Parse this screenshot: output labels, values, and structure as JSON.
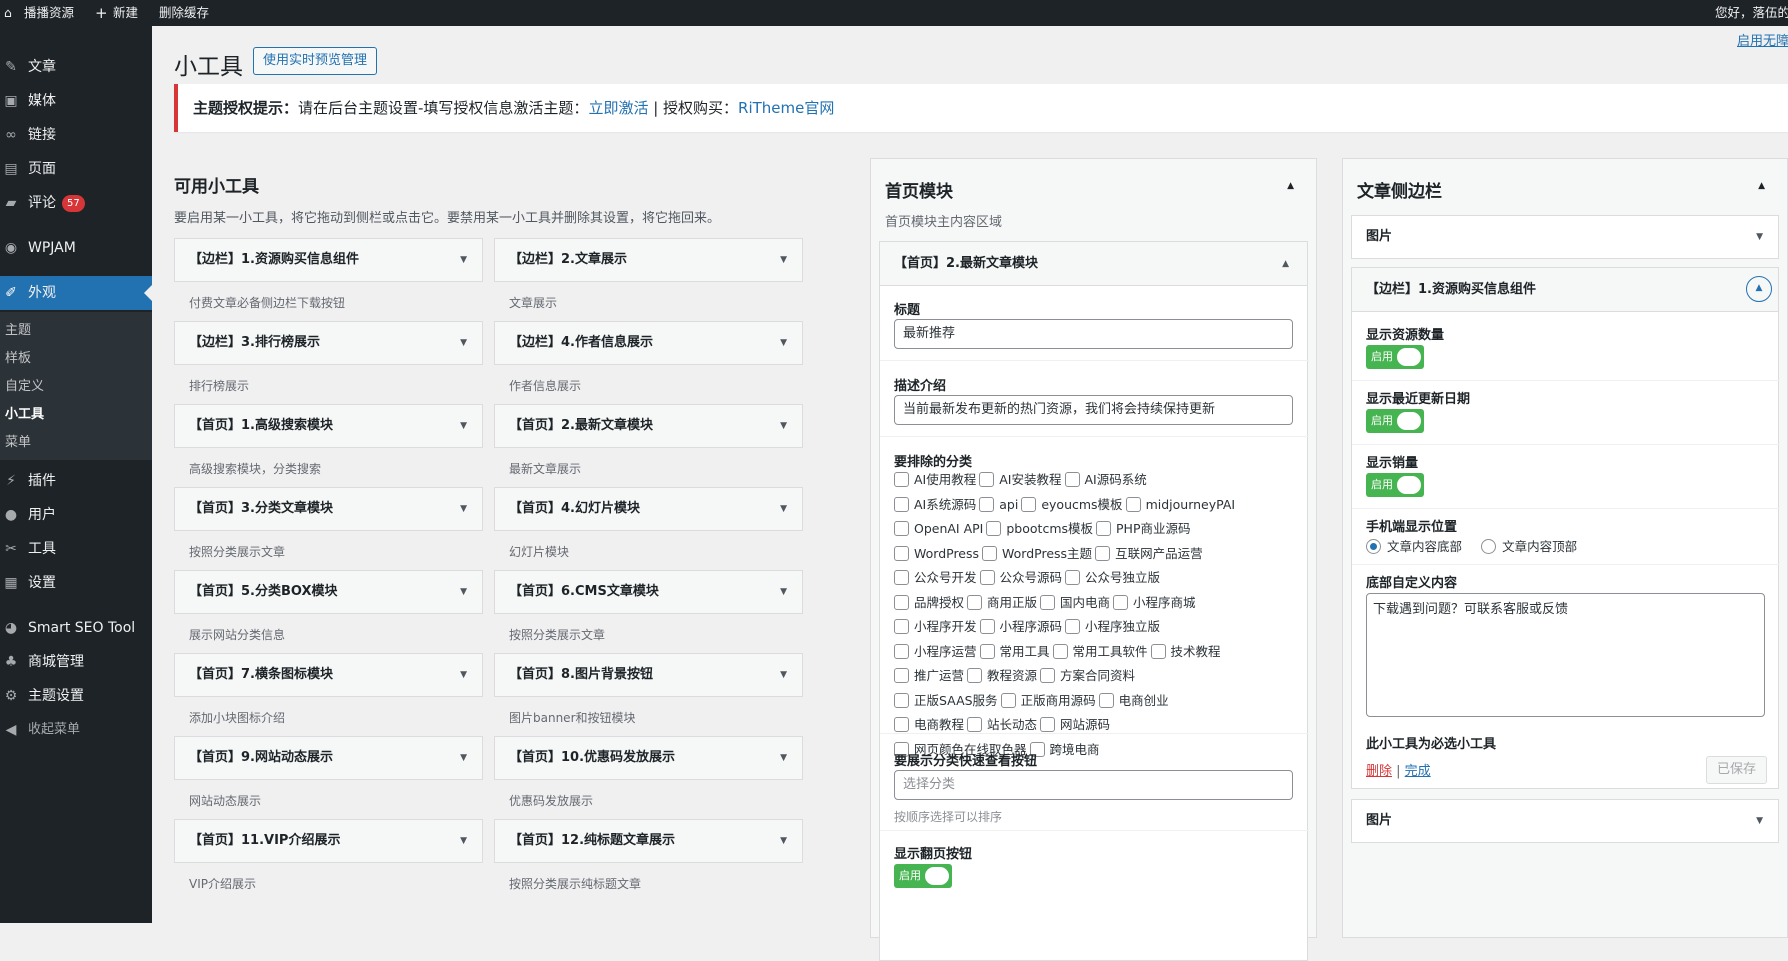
{
  "adminbar": {
    "site_name": "播播资源",
    "new_label": "新建",
    "clear_cache_label": "删除缓存",
    "greeting": "您好，落伍的"
  },
  "menu": {
    "posts": "文章",
    "media": "媒体",
    "links": "链接",
    "pages": "页面",
    "comments": "评论",
    "comments_count": "57",
    "wpjam": "WPJAM",
    "appearance": "外观",
    "sub_themes": "主题",
    "sub_patterns": "样板",
    "sub_customize": "自定义",
    "sub_widgets": "小工具",
    "sub_menus": "菜单",
    "plugins": "插件",
    "users": "用户",
    "tools": "工具",
    "settings": "设置",
    "seo": "Smart SEO Tool",
    "shop": "商城管理",
    "theme_settings": "主题设置",
    "collapse": "收起菜单"
  },
  "page": {
    "title": "小工具",
    "preview_button": "使用实时预览管理",
    "top_right_link": "启用无障"
  },
  "notice": {
    "bold": "主题授权提示：",
    "text": "请在后台主题设置-填写授权信息激活主题：",
    "activate_link": "立即激活",
    "divider": " | 授权购买：",
    "store_link": "RiTheme官网"
  },
  "available": {
    "heading": "可用小工具",
    "description": "要启用某一小工具，将它拖动到侧栏或点击它。要禁用某一小工具并删除其设置，将它拖回来。",
    "widgets": [
      {
        "title": "【边栏】1.资源购买信息组件",
        "desc": "付费文章必备侧边栏下载按钮"
      },
      {
        "title": "【边栏】2.文章展示",
        "desc": "文章展示"
      },
      {
        "title": "【边栏】3.排行榜展示",
        "desc": "排行榜展示"
      },
      {
        "title": "【边栏】4.作者信息展示",
        "desc": "作者信息展示"
      },
      {
        "title": "【首页】1.高级搜索模块",
        "desc": "高级搜索模块，分类搜索"
      },
      {
        "title": "【首页】2.最新文章模块",
        "desc": "最新文章展示"
      },
      {
        "title": "【首页】3.分类文章模块",
        "desc": "按照分类展示文章"
      },
      {
        "title": "【首页】4.幻灯片模块",
        "desc": "幻灯片模块"
      },
      {
        "title": "【首页】5.分类BOX模块",
        "desc": "展示网站分类信息"
      },
      {
        "title": "【首页】6.CMS文章模块",
        "desc": "按照分类展示文章"
      },
      {
        "title": "【首页】7.横条图标模块",
        "desc": "添加小块图标介绍"
      },
      {
        "title": "【首页】8.图片背景按钮",
        "desc": "图片banner和按钮模块"
      },
      {
        "title": "【首页】9.网站动态展示",
        "desc": "网站动态展示"
      },
      {
        "title": "【首页】10.优惠码发放展示",
        "desc": "优惠码发放展示"
      },
      {
        "title": "【首页】11.VIP介绍展示",
        "desc": "VIP介绍展示"
      },
      {
        "title": "【首页】12.纯标题文章展示",
        "desc": "按照分类展示纯标题文章"
      }
    ]
  },
  "home_sidebar": {
    "title": "首页模块",
    "description": "首页模块主内容区域",
    "widget_title": "【首页】2.最新文章模块",
    "title_label": "标题",
    "title_value": "最新推荐",
    "desc_label": "描述介绍",
    "desc_value": "当前最新发布更新的热门资源，我们将会持续保持更新",
    "exclude_label": "要排除的分类",
    "categories": [
      [
        "AI使用教程",
        "AI安装教程",
        "AI源码系统"
      ],
      [
        "AI系统源码",
        "api",
        "eyoucms模板",
        "midjourneyPAI"
      ],
      [
        "OpenAI API",
        "pbootcms模板",
        "PHP商业源码"
      ],
      [
        "WordPress",
        "WordPress主题",
        "互联网产品运营"
      ],
      [
        "公众号开发",
        "公众号源码",
        "公众号独立版"
      ],
      [
        "品牌授权",
        "商用正版",
        "国内电商",
        "小程序商城"
      ],
      [
        "小程序开发",
        "小程序源码",
        "小程序独立版"
      ],
      [
        "小程序运营",
        "常用工具",
        "常用工具软件",
        "技术教程"
      ],
      [
        "推广运营",
        "教程资源",
        "方案合同资料"
      ],
      [
        "正版SAAS服务",
        "正版商用源码",
        "电商创业"
      ],
      [
        "电商教程",
        "站长动态",
        "网站源码"
      ],
      [
        "网页颜色在线取色器",
        "跨境电商"
      ]
    ],
    "quick_label": "要展示分类快速查看按钮",
    "quick_placeholder": "选择分类",
    "quick_hint": "按顺序选择可以排序",
    "paging_label": "显示翻页按钮",
    "toggle_on": "启用"
  },
  "post_sidebar": {
    "title": "文章侧边栏",
    "image_widget": "图片",
    "widget_title": "【边栏】1.资源购买信息组件",
    "show_count_label": "显示资源数量",
    "show_updated_label": "显示最近更新日期",
    "show_sales_label": "显示销量",
    "toggle_on": "启用",
    "mobile_pos_label": "手机端显示位置",
    "mobile_pos_options": [
      "文章内容底部",
      "文章内容顶部"
    ],
    "bottom_custom_label": "底部自定义内容",
    "bottom_custom_value": "下载遇到问题？可联系客服或反馈",
    "required_note": "此小工具为必选小工具",
    "delete_link": "删除",
    "done_link": "完成",
    "saved_button": "已保存",
    "image_widget_2": "图片"
  }
}
